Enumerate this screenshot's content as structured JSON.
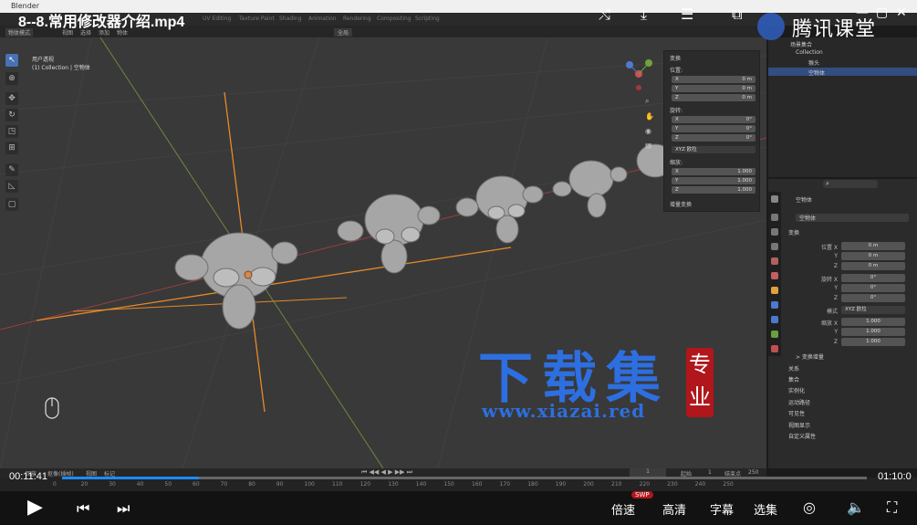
{
  "video": {
    "title": "8--8.常用修改器介绍.mp4",
    "brand": "腾讯课堂",
    "time_current": "00:11:41",
    "time_total": "01:10:0",
    "progress": 0.17,
    "speed_label": "倍速",
    "quality_label": "高清",
    "subtitle_label": "字幕",
    "episodes_label": "选集",
    "swp_badge": "SWP"
  },
  "blender": {
    "window_title": "Blender",
    "workspaces": [
      "UV Editing",
      "Texture Paint",
      "Shading",
      "Animation",
      "Rendering",
      "Compositing",
      "Scripting"
    ],
    "mode": "物体模式",
    "menus": [
      "视图",
      "选择",
      "添加",
      "物体"
    ],
    "transform_orientation": "全局",
    "viewport_info_line1": "用户透视",
    "viewport_info_line2": "(1) Collection | 空物体",
    "npanel": {
      "title": "变换",
      "location_label": "位置:",
      "location": [
        {
          "axis": "X",
          "value": "0 m"
        },
        {
          "axis": "Y",
          "value": "0 m"
        },
        {
          "axis": "Z",
          "value": "0 m"
        }
      ],
      "rotation_label": "旋转:",
      "rotation": [
        {
          "axis": "X",
          "value": "0°"
        },
        {
          "axis": "Y",
          "value": "0°"
        },
        {
          "axis": "Z",
          "value": "0°"
        }
      ],
      "rotation_mode": "XYZ 欧拉",
      "scale_label": "缩放:",
      "scale": [
        {
          "axis": "X",
          "value": "1.000"
        },
        {
          "axis": "Y",
          "value": "1.000"
        },
        {
          "axis": "Z",
          "value": "1.000"
        }
      ],
      "delta_label": "增量变换"
    },
    "outliner": {
      "scene_collection": "场景集合",
      "collection": "Collection",
      "items": [
        "猴头",
        "空物体"
      ]
    },
    "properties": {
      "object_name": "空物体",
      "object_name2": "空物体",
      "section_transform": "变换",
      "location_label": "位置 X",
      "location": [
        "0 m",
        "0 m",
        "0 m"
      ],
      "rotation_label": "旋转 X",
      "rotation": [
        "0°",
        "0°",
        "0°"
      ],
      "mode_label": "模式",
      "mode_value": "XYZ 欧拉",
      "scale_label": "缩放 X",
      "scale": [
        "1.000",
        "1.000",
        "1.000"
      ],
      "axis_y": "Y",
      "axis_z": "Z",
      "delta_label": "> 变换增量",
      "sections": [
        "关系",
        "集合",
        "实例化",
        "运动路径",
        "可见性",
        "视图显示",
        "自定义属性"
      ]
    },
    "timeline": {
      "menus": [
        "回放",
        "抠像(插帧)",
        "视图",
        "标记"
      ],
      "current_frame": "1",
      "start_label": "起始",
      "start": "1",
      "end_label": "结束点",
      "end": "250",
      "ticks": [
        "0",
        "20",
        "30",
        "40",
        "50",
        "60",
        "70",
        "80",
        "90",
        "100",
        "110",
        "120",
        "130",
        "140",
        "150",
        "160",
        "170",
        "180",
        "190",
        "200",
        "210",
        "220",
        "230",
        "240",
        "250"
      ]
    }
  },
  "watermark": {
    "text": "下载集",
    "url": "www.xiazai.red",
    "seal_top": "专",
    "seal_bottom": "业"
  }
}
